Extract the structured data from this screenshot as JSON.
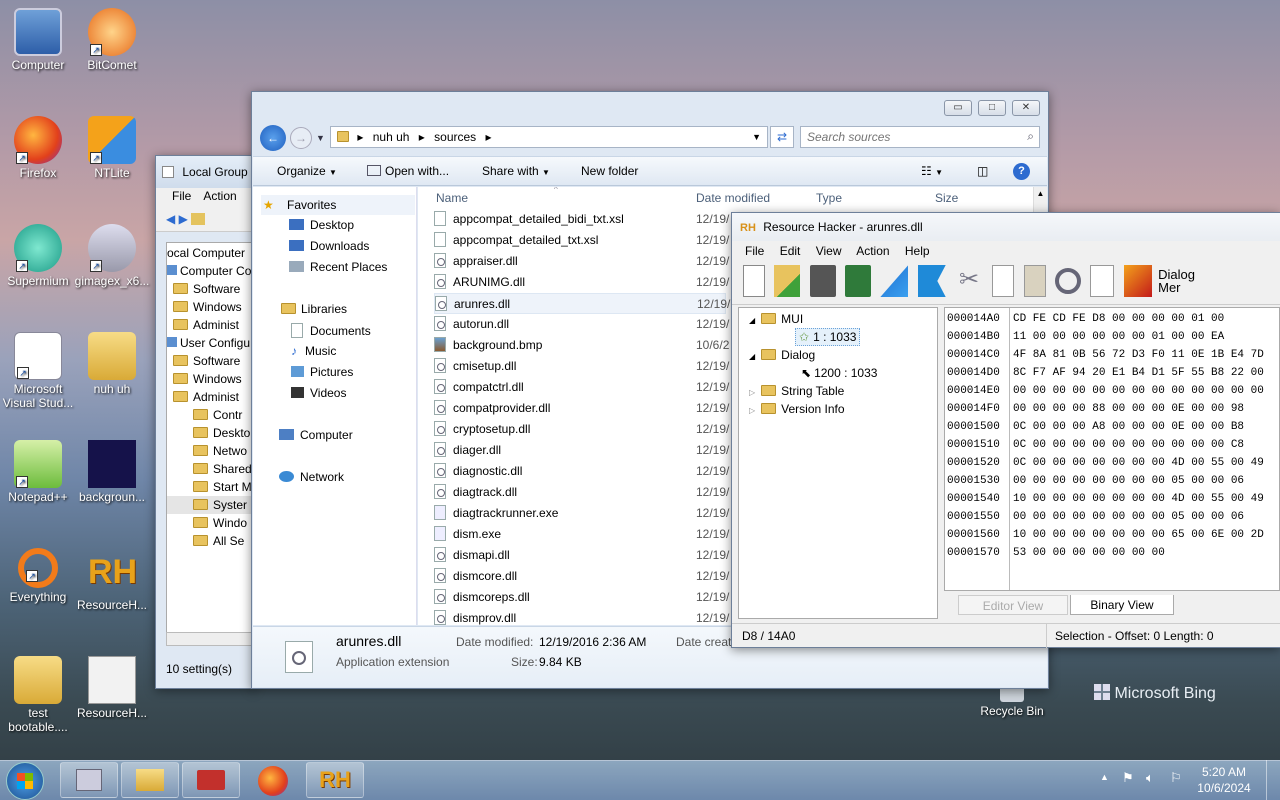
{
  "desktop": {
    "icons": [
      {
        "label": "Computer"
      },
      {
        "label": "BitComet"
      },
      {
        "label": "Firefox"
      },
      {
        "label": "NTLite"
      },
      {
        "label": "Supermium"
      },
      {
        "label": "gimagex_x6..."
      },
      {
        "label": "Microsoft Visual Stud..."
      },
      {
        "label": "nuh uh"
      },
      {
        "label": "Notepad++"
      },
      {
        "label": "backgroun..."
      },
      {
        "label": "Everything"
      },
      {
        "label": "ResourceH..."
      },
      {
        "label": "test bootable...."
      },
      {
        "label": "ResourceH..."
      }
    ],
    "recycle_bin": "Recycle Bin",
    "bing": "Microsoft Bing"
  },
  "gpedit": {
    "title": "Local Group",
    "menu": [
      "File",
      "Action"
    ],
    "tree": [
      "ocal Computer",
      "Computer Co",
      "Software",
      "Windows",
      "Administ",
      "User Configu",
      "Software",
      "Windows",
      "Administ",
      "Contr",
      "Deskto",
      "Netwo",
      "Shared",
      "Start M",
      "Syster",
      "Windo",
      "All Se"
    ],
    "status": "10 setting(s)"
  },
  "explorer": {
    "breadcrumb": [
      "nuh uh",
      "sources"
    ],
    "search_placeholder": "Search sources",
    "toolbar": {
      "organize": "Organize",
      "open_with": "Open with...",
      "share_with": "Share with",
      "new_folder": "New folder"
    },
    "nav": {
      "favorites": "Favorites",
      "desktop": "Desktop",
      "downloads": "Downloads",
      "recent": "Recent Places",
      "libraries": "Libraries",
      "documents": "Documents",
      "music": "Music",
      "pictures": "Pictures",
      "videos": "Videos",
      "computer": "Computer",
      "network": "Network"
    },
    "columns": {
      "name": "Name",
      "date": "Date modified",
      "type": "Type",
      "size": "Size"
    },
    "files": [
      {
        "name": "appcompat_detailed_bidi_txt.xsl",
        "date": "12/19/"
      },
      {
        "name": "appcompat_detailed_txt.xsl",
        "date": "12/19/"
      },
      {
        "name": "appraiser.dll",
        "date": "12/19/"
      },
      {
        "name": "ARUNIMG.dll",
        "date": "12/19/"
      },
      {
        "name": "arunres.dll",
        "date": "12/19/"
      },
      {
        "name": "autorun.dll",
        "date": "12/19/"
      },
      {
        "name": "background.bmp",
        "date": "10/6/2"
      },
      {
        "name": "cmisetup.dll",
        "date": "12/19/"
      },
      {
        "name": "compatctrl.dll",
        "date": "12/19/"
      },
      {
        "name": "compatprovider.dll",
        "date": "12/19/"
      },
      {
        "name": "cryptosetup.dll",
        "date": "12/19/"
      },
      {
        "name": "diager.dll",
        "date": "12/19/"
      },
      {
        "name": "diagnostic.dll",
        "date": "12/19/"
      },
      {
        "name": "diagtrack.dll",
        "date": "12/19/"
      },
      {
        "name": "diagtrackrunner.exe",
        "date": "12/19/"
      },
      {
        "name": "dism.exe",
        "date": "12/19/"
      },
      {
        "name": "dismapi.dll",
        "date": "12/19/"
      },
      {
        "name": "dismcore.dll",
        "date": "12/19/"
      },
      {
        "name": "dismcoreps.dll",
        "date": "12/19/"
      },
      {
        "name": "dismprov.dll",
        "date": "12/19/"
      }
    ],
    "details": {
      "name": "arunres.dll",
      "type": "Application extension",
      "modified_label": "Date modified:",
      "modified": "12/19/2016 2:36 AM",
      "size_label": "Size:",
      "size": "9.84 KB",
      "created_label": "Date creat"
    }
  },
  "reshacker": {
    "title": "Resource Hacker - arunres.dll",
    "menu": [
      "File",
      "Edit",
      "View",
      "Action",
      "Help"
    ],
    "dialog_menu": "Dialog Mer",
    "tree": {
      "mui": "MUI",
      "mui_item": "1 : 1033",
      "dialog": "Dialog",
      "dialog_item": "1200 : 1033",
      "string_table": "String Table",
      "version_info": "Version Info"
    },
    "hex": [
      {
        "addr": "000014A0",
        "bytes": "CD FE CD FE D8 00 00 00 00 01 00"
      },
      {
        "addr": "000014B0",
        "bytes": "11 00 00 00 00 00 00 01 00 00 EA"
      },
      {
        "addr": "000014C0",
        "bytes": "4F 8A 81 0B 56 72 D3 F0 11 0E 1B E4 7D"
      },
      {
        "addr": "000014D0",
        "bytes": "8C F7 AF 94 20 E1 B4 D1 5F 55 B8 22 00"
      },
      {
        "addr": "000014E0",
        "bytes": "00 00 00 00 00 00 00 00 00 00 00 00 00"
      },
      {
        "addr": "000014F0",
        "bytes": "00 00 00 00 88 00 00 00 0E 00 00 98"
      },
      {
        "addr": "00001500",
        "bytes": "0C 00 00 00 A8 00 00 00 0E 00 00 B8"
      },
      {
        "addr": "00001510",
        "bytes": "0C 00 00 00 00 00 00 00 00 00 00 C8"
      },
      {
        "addr": "00001520",
        "bytes": "0C 00 00 00 00 00 00 00 4D 00 55 00 49"
      },
      {
        "addr": "00001530",
        "bytes": "00 00 00 00 00 00 00 00 05 00 00 06"
      },
      {
        "addr": "00001540",
        "bytes": "10 00 00 00 00 00 00 00 4D 00 55 00 49"
      },
      {
        "addr": "00001550",
        "bytes": "00 00 00 00 00 00 00 00 05 00 00 06"
      },
      {
        "addr": "00001560",
        "bytes": "10 00 00 00 00 00 00 00 65 00 6E 00 2D"
      },
      {
        "addr": "00001570",
        "bytes": "53 00 00 00 00 00 00 00"
      }
    ],
    "tabs": {
      "editor": "Editor View",
      "binary": "Binary View"
    },
    "status_left": "D8 / 14A0",
    "status_right": "Selection - Offset: 0  Length: 0"
  },
  "taskbar": {
    "time": "5:20 AM",
    "date": "10/6/2024"
  }
}
